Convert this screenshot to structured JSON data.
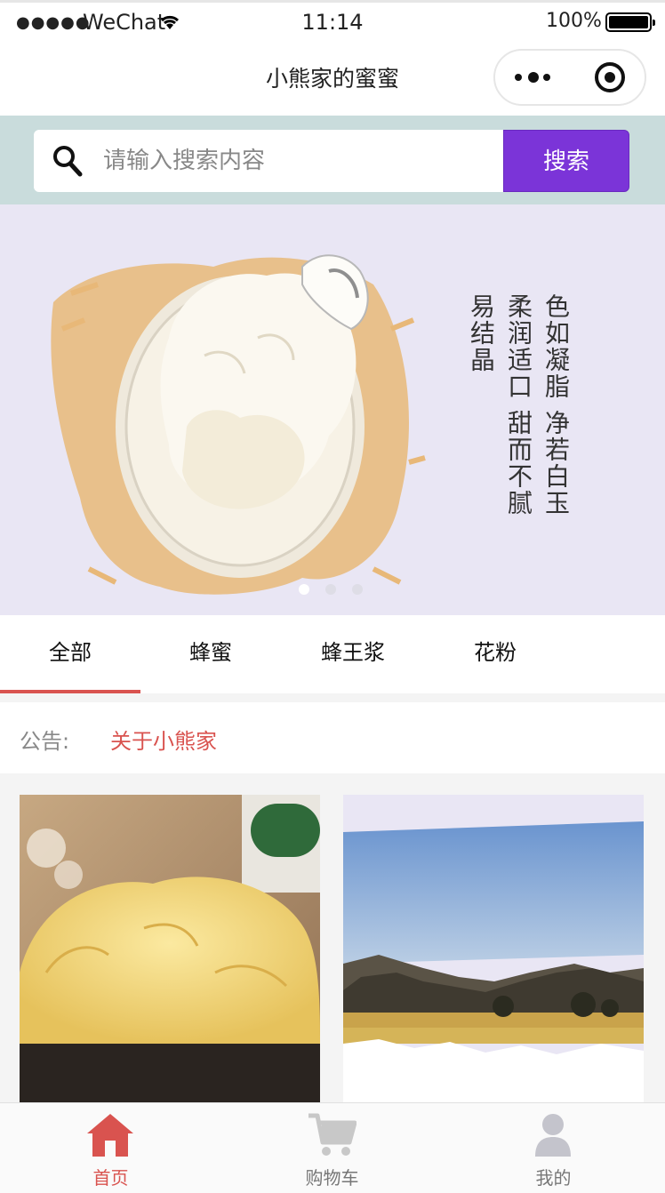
{
  "status_bar": {
    "signal": "●●●●●",
    "carrier": "WeChat",
    "time": "11:14",
    "battery_pct": "100%"
  },
  "navbar": {
    "title": "小熊家的蜜蜜"
  },
  "search": {
    "placeholder": "请输入搜索内容",
    "value": "",
    "button_label": "搜索"
  },
  "banner": {
    "text_columns": [
      "色如凝脂 净若白玉",
      "柔润适口 甜而不腻",
      "易结晶"
    ],
    "slide_count": 3,
    "active_slide": 1
  },
  "category_tabs": [
    {
      "label": "全部",
      "active": true
    },
    {
      "label": "蜂蜜",
      "active": false
    },
    {
      "label": "蜂王浆",
      "active": false
    },
    {
      "label": "花粉",
      "active": false
    }
  ],
  "notice": {
    "label": "公告:",
    "link_text": "关于小熊家"
  },
  "products": [
    {
      "image": "crystallized-honey-bowl"
    },
    {
      "image": "mountain-grassland-landscape"
    }
  ],
  "tabbar": [
    {
      "label": "首页",
      "icon": "home-icon",
      "active": true
    },
    {
      "label": "购物车",
      "icon": "cart-icon",
      "active": false
    },
    {
      "label": "我的",
      "icon": "user-icon",
      "active": false
    }
  ],
  "colors": {
    "accent": "#d9534f",
    "search_button": "#7b34d8",
    "search_bg": "#c9dcdc",
    "banner_bg": "#e9e6f4"
  }
}
